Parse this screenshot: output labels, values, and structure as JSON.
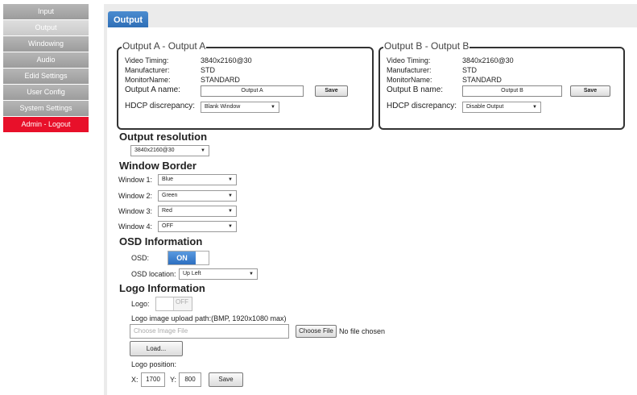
{
  "sidebar": {
    "items": [
      {
        "label": "Input"
      },
      {
        "label": "Output"
      },
      {
        "label": "Windowing"
      },
      {
        "label": "Audio"
      },
      {
        "label": "Edid Settings"
      },
      {
        "label": "User Config"
      },
      {
        "label": "System Settings"
      },
      {
        "label": "Admin - Logout"
      }
    ]
  },
  "page": {
    "title": "Output"
  },
  "output_a": {
    "title": "Output A - Output A",
    "video_timing_label": "Video Timing:",
    "video_timing": "3840x2160@30",
    "manufacturer_label": "Manufacturer:",
    "manufacturer": "STD",
    "monitor_name_label": "MonitorName:",
    "monitor_name": "STANDARD",
    "name_label": "Output A name:",
    "name_value": "Output A",
    "save_label": "Save",
    "hdcp_label": "HDCP discrepancy:",
    "hdcp_value": "Blank Window"
  },
  "output_b": {
    "title": "Output B - Output B",
    "video_timing_label": "Video Timing:",
    "video_timing": "3840x2160@30",
    "manufacturer_label": "Manufacturer:",
    "manufacturer": "STD",
    "monitor_name_label": "MonitorName:",
    "monitor_name": "STANDARD",
    "name_label": "Output B name:",
    "name_value": "Output B",
    "save_label": "Save",
    "hdcp_label": "HDCP discrepancy:",
    "hdcp_value": "Disable Output"
  },
  "resolution": {
    "title": "Output resolution",
    "value": "3840x2160@30"
  },
  "window_border": {
    "title": "Window Border",
    "windows": [
      {
        "label": "Window 1:",
        "value": "Blue"
      },
      {
        "label": "Window 2:",
        "value": "Green"
      },
      {
        "label": "Window 3:",
        "value": "Red"
      },
      {
        "label": "Window 4:",
        "value": "OFF"
      }
    ]
  },
  "osd": {
    "title": "OSD Information",
    "osd_label": "OSD:",
    "osd_state": "ON",
    "location_label": "OSD location:",
    "location_value": "Up Left"
  },
  "logo": {
    "title": "Logo Information",
    "logo_label": "Logo:",
    "logo_state": "OFF",
    "upload_label": "Logo image upload path:(BMP, 1920x1080 max)",
    "file_placeholder": "Choose Image File",
    "choose_file_label": "Choose File",
    "no_file_text": "No file chosen",
    "load_label": "Load...",
    "position_label": "Logo position:",
    "x_label": "X:",
    "x_value": "1700",
    "y_label": "Y:",
    "y_value": "800",
    "save_label": "Save"
  },
  "colors": {
    "accent_blue": "#2c6cb4",
    "logout_red": "#e8102a",
    "sidebar_gray": "#a8a8a8"
  }
}
